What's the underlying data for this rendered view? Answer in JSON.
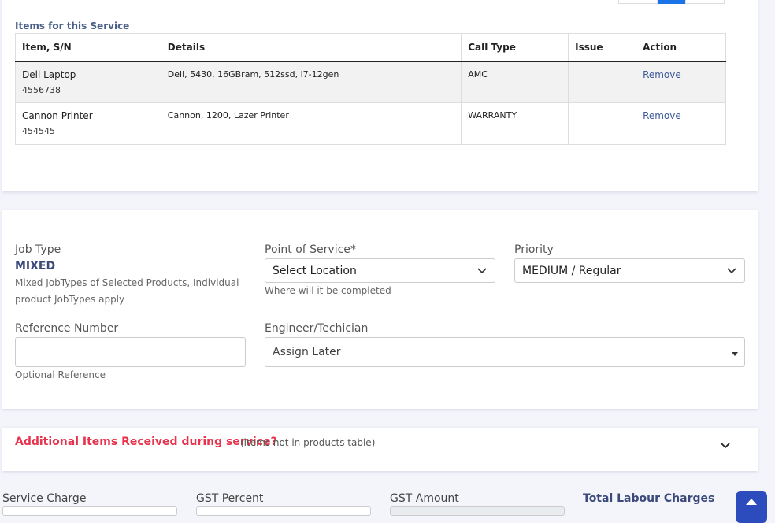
{
  "items_section": {
    "title": "Items for this Service",
    "columns": [
      "Item, S/N",
      "Details",
      "Call Type",
      "Issue",
      "Action"
    ],
    "rows": [
      {
        "item": "Dell Laptop",
        "sn": "4556738",
        "details": "Dell, 5430, 16GBram, 512ssd, i7-12gen",
        "call_type": "AMC",
        "issue": "",
        "action": "Remove"
      },
      {
        "item": "Cannon Printer",
        "sn": "454545",
        "details": "Cannon, 1200, Lazer Printer",
        "call_type": "WARRANTY",
        "issue": "",
        "action": "Remove"
      }
    ]
  },
  "job": {
    "job_type_label": "Job Type",
    "job_type_value": "MIXED",
    "job_type_hint": "Mixed JobTypes of Selected Products, Individual product JobTypes apply",
    "point_of_service_label": "Point of Service*",
    "point_of_service_value": "Select Location",
    "point_of_service_hint": "Where will it be completed",
    "priority_label": "Priority",
    "priority_value": "MEDIUM / Regular",
    "reference_label": "Reference Number",
    "reference_value": "",
    "reference_hint": "Optional Reference",
    "engineer_label": "Engineer/Techician",
    "engineer_value": "Assign Later"
  },
  "additional": {
    "title": "Additional Items Received during service?",
    "note": "(items not in products table)"
  },
  "charges": {
    "service_charge_label": "Service Charge",
    "gst_percent_label": "GST Percent",
    "gst_amount_label": "GST Amount",
    "total_labour_label": "Total Labour Charges"
  },
  "icons": {
    "chevron": "chevron-down-icon",
    "scroll_top": "arrow-up-icon"
  },
  "colors": {
    "accent": "#1a73e8",
    "alert_red": "#e8334d",
    "heading_blue": "#3b4a7a",
    "button_blue": "#2c4bbd"
  }
}
